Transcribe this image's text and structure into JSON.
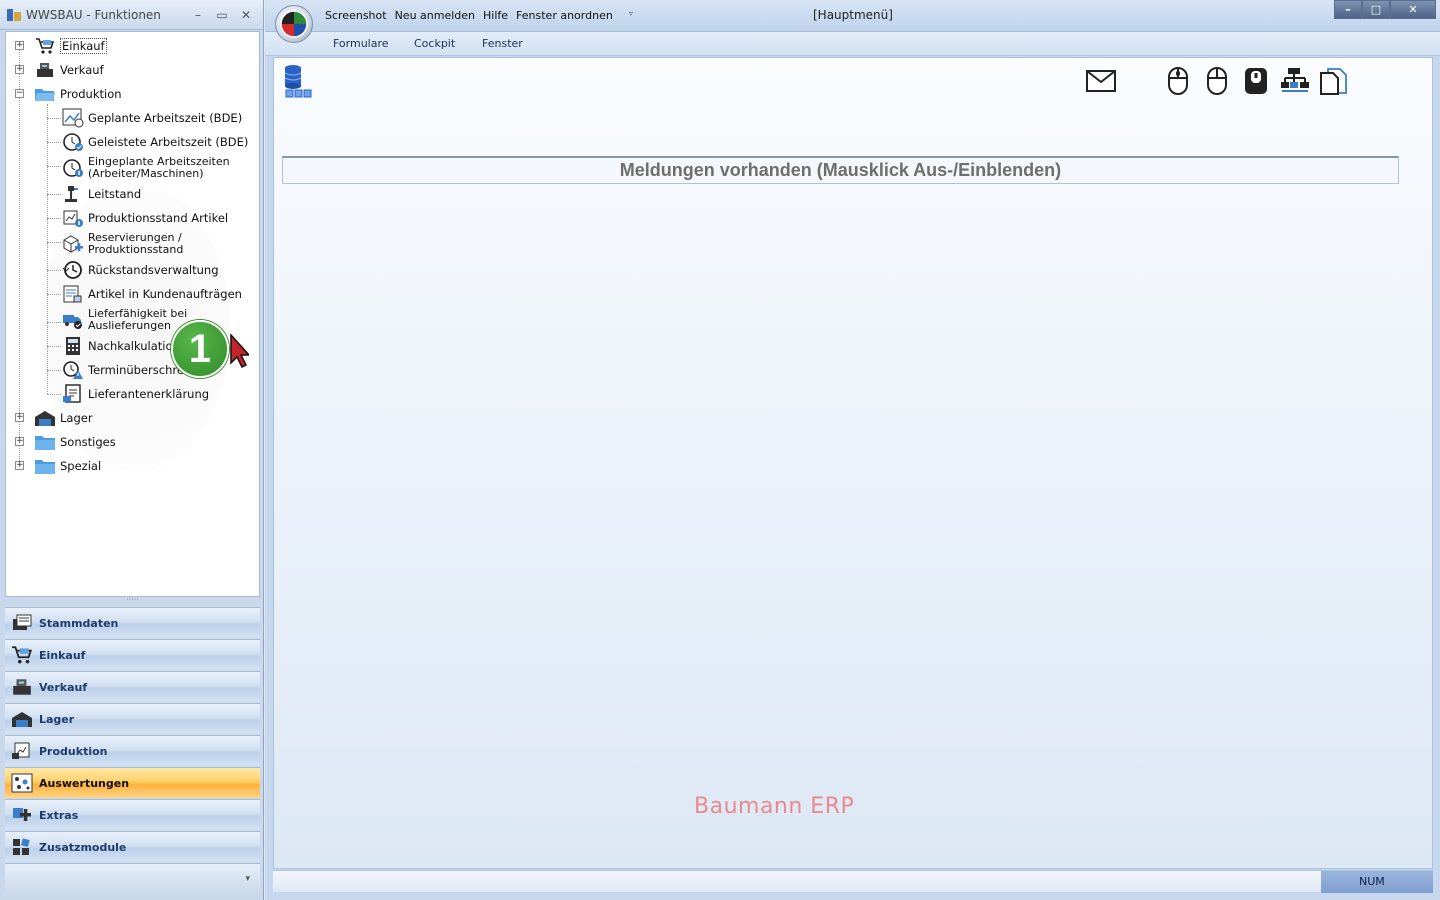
{
  "left_panel": {
    "title": "WWSBAU - Funktionen",
    "tree": [
      {
        "label": "Einkauf",
        "expander": "+",
        "icon": "cart-icon"
      },
      {
        "label": "Verkauf",
        "expander": "+",
        "icon": "cash-register-icon"
      },
      {
        "label": "Produktion",
        "expander": "−",
        "icon": "open-folder-icon"
      },
      {
        "label": "Geplante Arbeitszeit (BDE)",
        "icon": "planned-time-icon"
      },
      {
        "label": "Geleistete Arbeitszeit (BDE)",
        "icon": "clock-check-icon"
      },
      {
        "label": "Eingeplante Arbeitszeiten",
        "label2": "(Arbeiter/Maschinen)",
        "icon": "clock-info-icon"
      },
      {
        "label": "Leitstand",
        "icon": "control-station-icon"
      },
      {
        "label": "Produktionsstand Artikel",
        "icon": "production-status-icon"
      },
      {
        "label": "Reservierungen /",
        "label2": "Produktionsstand",
        "icon": "reservation-icon"
      },
      {
        "label": "Rückstandsverwaltung",
        "icon": "backlog-clock-icon"
      },
      {
        "label": "Artikel in Kundenaufträgen",
        "icon": "article-orders-icon"
      },
      {
        "label": "Lieferfähigkeit bei",
        "label2": "Auslieferungen",
        "icon": "delivery-truck-icon"
      },
      {
        "label": "Nachkalkulation",
        "icon": "calculator-icon"
      },
      {
        "label": "Terminüberschreitung",
        "icon": "deadline-warning-icon"
      },
      {
        "label": "Lieferantenerklärung",
        "icon": "supplier-declaration-icon"
      },
      {
        "label": "Lager",
        "expander": "+",
        "icon": "warehouse-icon"
      },
      {
        "label": "Sonstiges",
        "expander": "+",
        "icon": "folder-icon"
      },
      {
        "label": "Spezial",
        "expander": "+",
        "icon": "folder-icon"
      }
    ],
    "nav_buttons": [
      {
        "label": "Stammdaten",
        "icon": "master-data-icon"
      },
      {
        "label": "Einkauf",
        "icon": "cart-icon"
      },
      {
        "label": "Verkauf",
        "icon": "cash-register-icon"
      },
      {
        "label": "Lager",
        "icon": "warehouse-icon"
      },
      {
        "label": "Produktion",
        "icon": "production-icon"
      },
      {
        "label": "Auswertungen",
        "icon": "analytics-icon",
        "active": true
      },
      {
        "label": "Extras",
        "icon": "extras-icon"
      },
      {
        "label": "Zusatzmodule",
        "icon": "modules-icon"
      }
    ],
    "step_badge": "1"
  },
  "main_window": {
    "title": "[Hauptmenü]",
    "quick_access": [
      "Screenshot",
      "Neu anmelden",
      "Hilfe",
      "Fenster anordnen"
    ],
    "menu": [
      "Formulare",
      "Cockpit",
      "Fenster"
    ],
    "toolbar_icons": [
      "mail-icon",
      "mouse-left-icon",
      "mouse-right-icon",
      "mouse-dark-icon",
      "hierarchy-icon",
      "documents-icon"
    ],
    "message_bar": "Meldungen vorhanden  (Mausklick Aus-/Einblenden)",
    "brand": "Baumann ERP",
    "status": {
      "num": "NUM"
    }
  },
  "colors": {
    "accent": "#ffb23a",
    "brand": "#e88a8e",
    "badge": "#3c9d33"
  }
}
